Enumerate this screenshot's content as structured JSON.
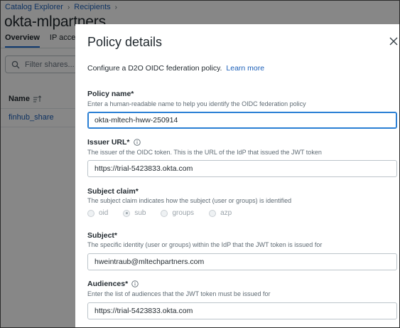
{
  "breadcrumb": {
    "items": [
      "Catalog Explorer",
      "Recipients"
    ],
    "separator": "›"
  },
  "page": {
    "title": "okta-mlpartners"
  },
  "tabs": [
    {
      "label": "Overview",
      "active": true
    },
    {
      "label": "IP access",
      "active": false
    }
  ],
  "search": {
    "placeholder": "Filter shares..."
  },
  "table": {
    "column_name": "Name",
    "rows": [
      "finhub_share"
    ]
  },
  "modal": {
    "title": "Policy details",
    "intro": "Configure a D2O OIDC federation policy.",
    "learn_more": "Learn more",
    "policy_name": {
      "label": "Policy name*",
      "help": "Enter a human-readable name to help you identify the OIDC federation policy",
      "value": "okta-mltech-hww-250914"
    },
    "issuer_url": {
      "label": "Issuer URL*",
      "help": "The issuer of the OIDC token. This is the URL of the IdP that issued the JWT token",
      "value": "https://trial-5423833.okta.com"
    },
    "subject_claim": {
      "label": "Subject claim*",
      "help": "The subject claim indicates how the subject (user or groups) is identified",
      "options": [
        "oid",
        "sub",
        "groups",
        "azp"
      ],
      "selected": "sub"
    },
    "subject": {
      "label": "Subject*",
      "help": "The specific identity (user or groups) within the IdP that the JWT token is issued for",
      "value": "hweintraub@mltechpartners.com"
    },
    "audiences": {
      "label": "Audiences*",
      "help": "Enter the list of audiences that the JWT token must be issued for",
      "value": "https://trial-5423833.okta.com"
    }
  },
  "colors": {
    "link": "#1b5fb8",
    "accent": "#1f6fd1",
    "focus": "#2a7fd4",
    "overlay": "rgba(0,0,0,0.47)"
  }
}
